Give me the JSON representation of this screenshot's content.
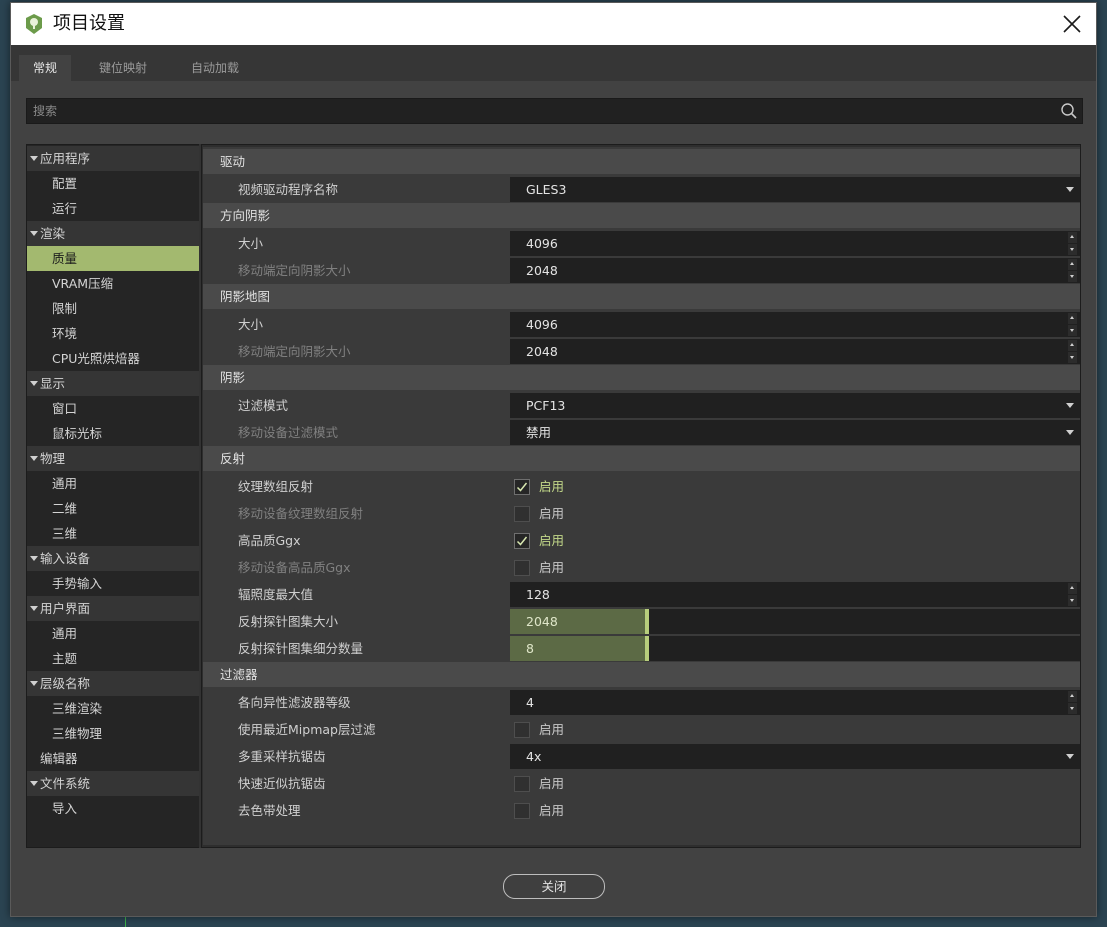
{
  "window": {
    "title": "项目设置"
  },
  "tabs": [
    {
      "label": "常规",
      "active": true
    },
    {
      "label": "键位映射",
      "active": false
    },
    {
      "label": "自动加载",
      "active": false
    }
  ],
  "search": {
    "placeholder": "搜索"
  },
  "sidebar": {
    "items": [
      {
        "label": "应用程序",
        "type": "category"
      },
      {
        "label": "配置",
        "type": "item"
      },
      {
        "label": "运行",
        "type": "item"
      },
      {
        "label": "渲染",
        "type": "category"
      },
      {
        "label": "质量",
        "type": "item",
        "selected": true
      },
      {
        "label": "VRAM压缩",
        "type": "item"
      },
      {
        "label": "限制",
        "type": "item"
      },
      {
        "label": "环境",
        "type": "item"
      },
      {
        "label": "CPU光照烘焙器",
        "type": "item"
      },
      {
        "label": "显示",
        "type": "category"
      },
      {
        "label": "窗口",
        "type": "item"
      },
      {
        "label": "鼠标光标",
        "type": "item"
      },
      {
        "label": "物理",
        "type": "category"
      },
      {
        "label": "通用",
        "type": "item"
      },
      {
        "label": "二维",
        "type": "item"
      },
      {
        "label": "三维",
        "type": "item"
      },
      {
        "label": "输入设备",
        "type": "category"
      },
      {
        "label": "手势输入",
        "type": "item"
      },
      {
        "label": "用户界面",
        "type": "category"
      },
      {
        "label": "通用",
        "type": "item"
      },
      {
        "label": "主题",
        "type": "item"
      },
      {
        "label": "层级名称",
        "type": "category"
      },
      {
        "label": "三维渲染",
        "type": "item"
      },
      {
        "label": "三维物理",
        "type": "item"
      },
      {
        "label": "编辑器",
        "type": "plain"
      },
      {
        "label": "文件系统",
        "type": "category"
      },
      {
        "label": "导入",
        "type": "item"
      }
    ]
  },
  "sections": [
    {
      "title": "驱动",
      "props": [
        {
          "label": "视频驱动程序名称",
          "dim": false,
          "kind": "dropdown",
          "value": "GLES3"
        }
      ]
    },
    {
      "title": "方向阴影",
      "props": [
        {
          "label": "大小",
          "dim": false,
          "kind": "spin",
          "value": "4096"
        },
        {
          "label": "移动端定向阴影大小",
          "dim": true,
          "kind": "spin",
          "value": "2048"
        }
      ]
    },
    {
      "title": "阴影地图",
      "props": [
        {
          "label": "大小",
          "dim": false,
          "kind": "spin",
          "value": "4096"
        },
        {
          "label": "移动端定向阴影大小",
          "dim": true,
          "kind": "spin",
          "value": "2048"
        }
      ]
    },
    {
      "title": "阴影",
      "props": [
        {
          "label": "过滤模式",
          "dim": false,
          "kind": "dropdown",
          "value": "PCF13"
        },
        {
          "label": "移动设备过滤模式",
          "dim": true,
          "kind": "dropdown",
          "value": "禁用"
        }
      ]
    },
    {
      "title": "反射",
      "props": [
        {
          "label": "纹理数组反射",
          "dim": false,
          "kind": "check",
          "checked": true,
          "value": "启用"
        },
        {
          "label": "移动设备纹理数组反射",
          "dim": true,
          "kind": "check",
          "checked": false,
          "value": "启用"
        },
        {
          "label": "高品质Ggx",
          "dim": false,
          "kind": "check",
          "checked": true,
          "value": "启用"
        },
        {
          "label": "移动设备高品质Ggx",
          "dim": true,
          "kind": "check",
          "checked": false,
          "value": "启用"
        },
        {
          "label": "辐照度最大值",
          "dim": false,
          "kind": "spin",
          "value": "128"
        },
        {
          "label": "反射探针图集大小",
          "dim": false,
          "kind": "slider",
          "value": "2048",
          "fraction": 0.24
        },
        {
          "label": "反射探针图集细分数量",
          "dim": false,
          "kind": "slider",
          "value": "8",
          "fraction": 0.24
        }
      ]
    },
    {
      "title": "过滤器",
      "props": [
        {
          "label": "各向异性滤波器等级",
          "dim": false,
          "kind": "spin",
          "value": "4"
        },
        {
          "label": "使用最近Mipmap层过滤",
          "dim": false,
          "kind": "check",
          "checked": false,
          "value": "启用"
        },
        {
          "label": "多重采样抗锯齿",
          "dim": false,
          "kind": "dropdown",
          "value": "4x"
        },
        {
          "label": "快速近似抗锯齿",
          "dim": false,
          "kind": "check",
          "checked": false,
          "value": "启用"
        },
        {
          "label": "去色带处理",
          "dim": false,
          "kind": "check",
          "checked": false,
          "value": "启用"
        }
      ]
    }
  ],
  "footer": {
    "close_label": "关闭"
  },
  "colors": {
    "accent": "#a3b96f",
    "accent_text": "#c3d98a",
    "panel": "#424242",
    "field": "#202020"
  }
}
